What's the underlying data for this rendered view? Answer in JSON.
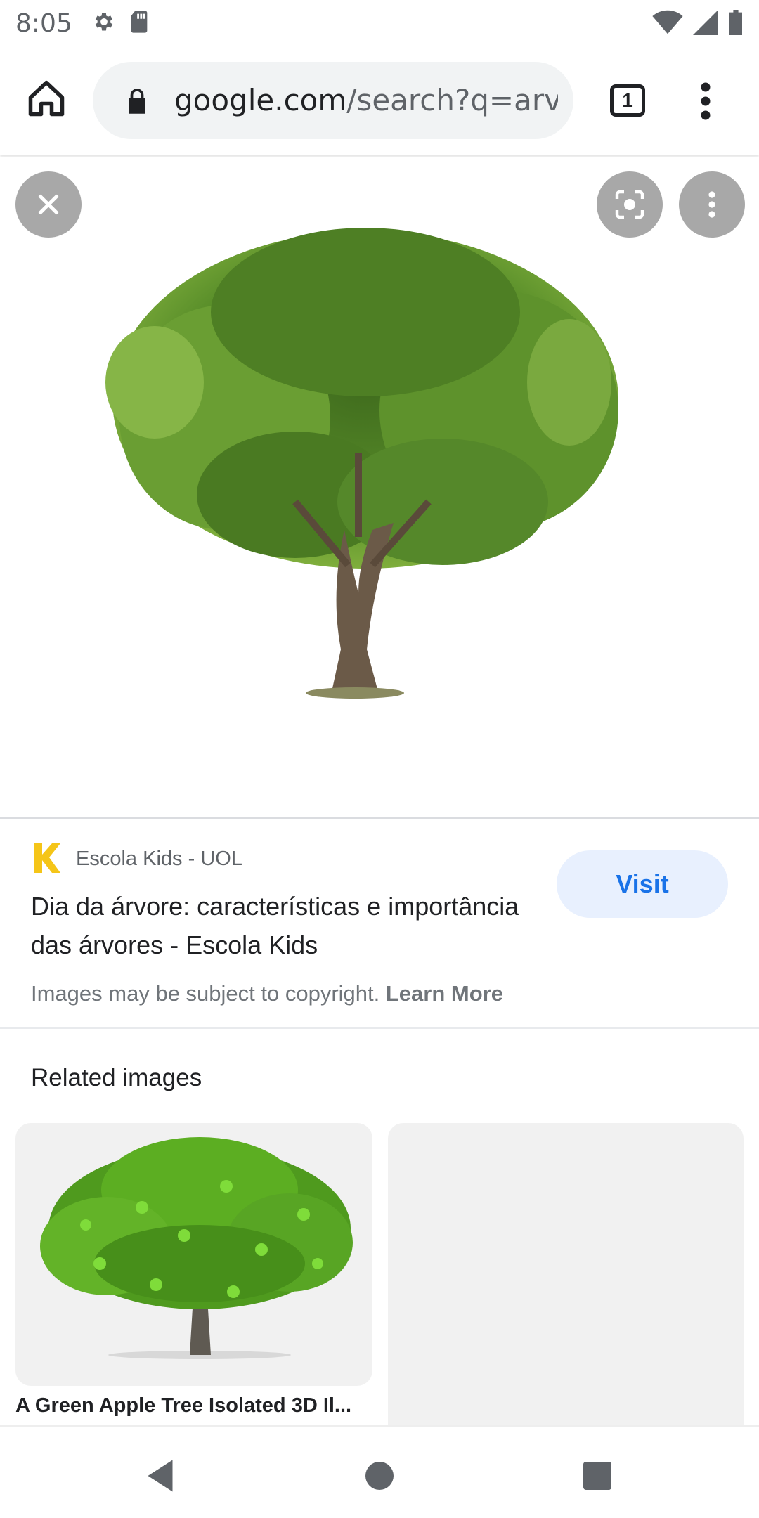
{
  "status_bar": {
    "time": "8:05",
    "icons": [
      "settings-icon",
      "sd-card-icon",
      "wifi-icon",
      "cell-signal-icon",
      "battery-icon"
    ]
  },
  "browser": {
    "url_host": "google.com",
    "url_path": "/search?q=arvore",
    "tab_count": "1"
  },
  "result": {
    "source_name": "Escola Kids - UOL",
    "title": "Dia da árvore: características e importância das árvores - Escola Kids",
    "visit_label": "Visit",
    "copyright_text": "Images may be subject to copyright.",
    "learn_more_label": "Learn More"
  },
  "related": {
    "heading": "Related images",
    "items": [
      {
        "caption": "A Green Apple Tree Isolated 3D Il..."
      }
    ]
  },
  "colors": {
    "accent_blue": "#1a73e8",
    "visit_bg": "#e8f0fe",
    "omnibox_bg": "#f1f3f4",
    "favicon_yellow": "#f5c518"
  }
}
